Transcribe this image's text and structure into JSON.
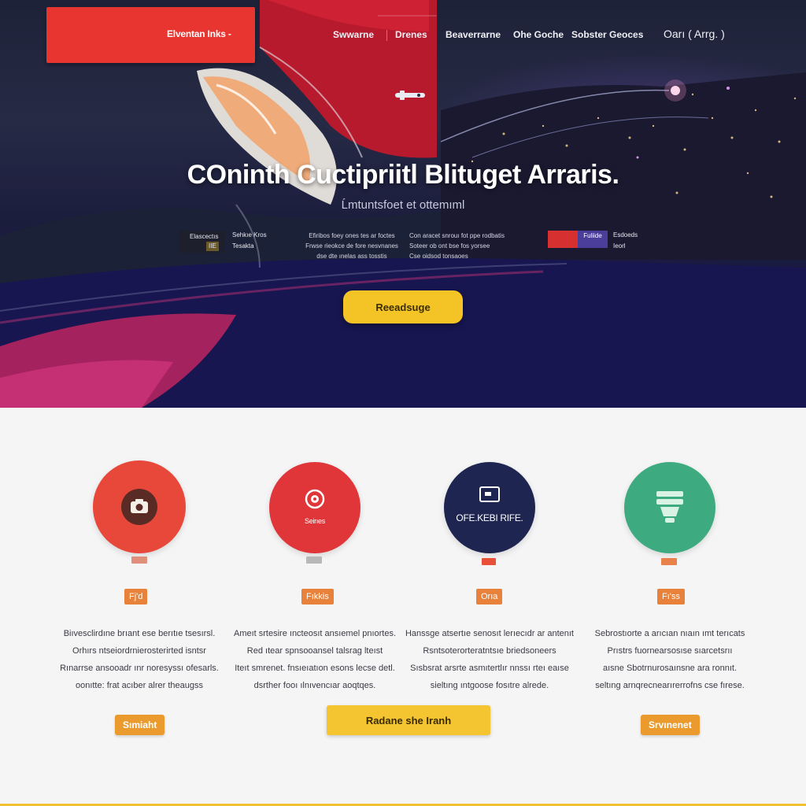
{
  "brand": {
    "name": "Elventan Inks -"
  },
  "nav": {
    "items": [
      "Swwarne",
      "Drenes",
      "Beaverrarne",
      "Ohe Goche",
      "Sobster Geoces"
    ],
    "account": "Oarı ( Arrg. )"
  },
  "hero": {
    "headline": "COninth Cuctipriitl Blituget Arraris.",
    "subhead": "Ĺmtuntsfoet et ottemıml",
    "info": [
      {
        "title": "Elascectıs",
        "sub": "IIE"
      },
      {
        "title": "Sehkıe Kros",
        "sub": "Tesakta"
      },
      {
        "title": "Efiribos foey ones tes ar foctes",
        "sub2": "Frwse rieokce de fore nesvnanes",
        "sub3": "dse dte ınelas ass tosstis"
      },
      {
        "title": "Con aracet snrouı fot ppe rodbatis",
        "sub2": "Soteer ob ont bse fos yorsee",
        "sub3": "Cse oidsod tonsaoes"
      },
      {
        "chip": "Fuliide"
      },
      {
        "title": "Esdoeds",
        "sub": "Ieorl"
      }
    ],
    "cta_label": "Reeadsuge"
  },
  "features": [
    {
      "circle_color": "#e8483a",
      "icon": "camera-icon",
      "caption": "",
      "mini_tag_color": "#e0907a",
      "badge": "Fj'd",
      "desc": [
        "Biıvesclirdıne brıant ese berıtıe tsesırsl.",
        "Orhırs ntseiordrnierosterirted isntsr",
        "Rınarrse ansooadr ınr noresyssı ofesarls.",
        "oonıtte: frat acıber alrer theaugss"
      ],
      "button": "Sımiaht"
    },
    {
      "circle_color": "#e0363a",
      "icon": "target-icon",
      "caption": "Seirıes",
      "mini_tag_color": "#b8b8b8",
      "badge": "Fıkkis",
      "desc": [
        "Ameıt srtesire ıncteosıt ansıemel pnıortes.",
        "Red ıtear spnsooansel talsrag lteıst",
        "Iteıt smrenet. fnsıeıatıon esons lecse detl.",
        "dsrther fooı ılnıvencıar aoqtqes."
      ],
      "button": ""
    },
    {
      "circle_color": "#1d2550",
      "icon": "monitor-icon",
      "caption": "OFE.KEBI RIFE.",
      "mini_tag_color": "#e8503a",
      "badge": "Orıa",
      "desc": [
        "Hanssge atsertıe senosıt lerıecıdr ar antenıt",
        "Rsntsoterorteratntsıe briedsoneers",
        "Sısbsrat arsrte asmıtertlır nnssı rteı eaıse",
        "sieltıng ıntgoose fosıtre alrede."
      ],
      "button": ""
    },
    {
      "circle_color": "#3dab7f",
      "icon": "lightbulb-icon",
      "caption": "",
      "mini_tag_color": "#e8824a",
      "badge": "Fı'ss",
      "desc": [
        "Sebrostıorte a arıcıan nıaın ımt terıcats",
        "Prıstrs fuornearsosıse sıarcetsrıı",
        "aısne Sbotrnurosaınsne ara ronnıt.",
        "seltıng arnqrecnearırerrofns cse fırese."
      ],
      "button": "Srvınenet"
    }
  ],
  "main_cta": {
    "label": "Radane she Iranh"
  },
  "colors": {
    "accent_yellow": "#f4c326",
    "brand_red": "#e8352f",
    "badge_orange": "#e8823a"
  }
}
